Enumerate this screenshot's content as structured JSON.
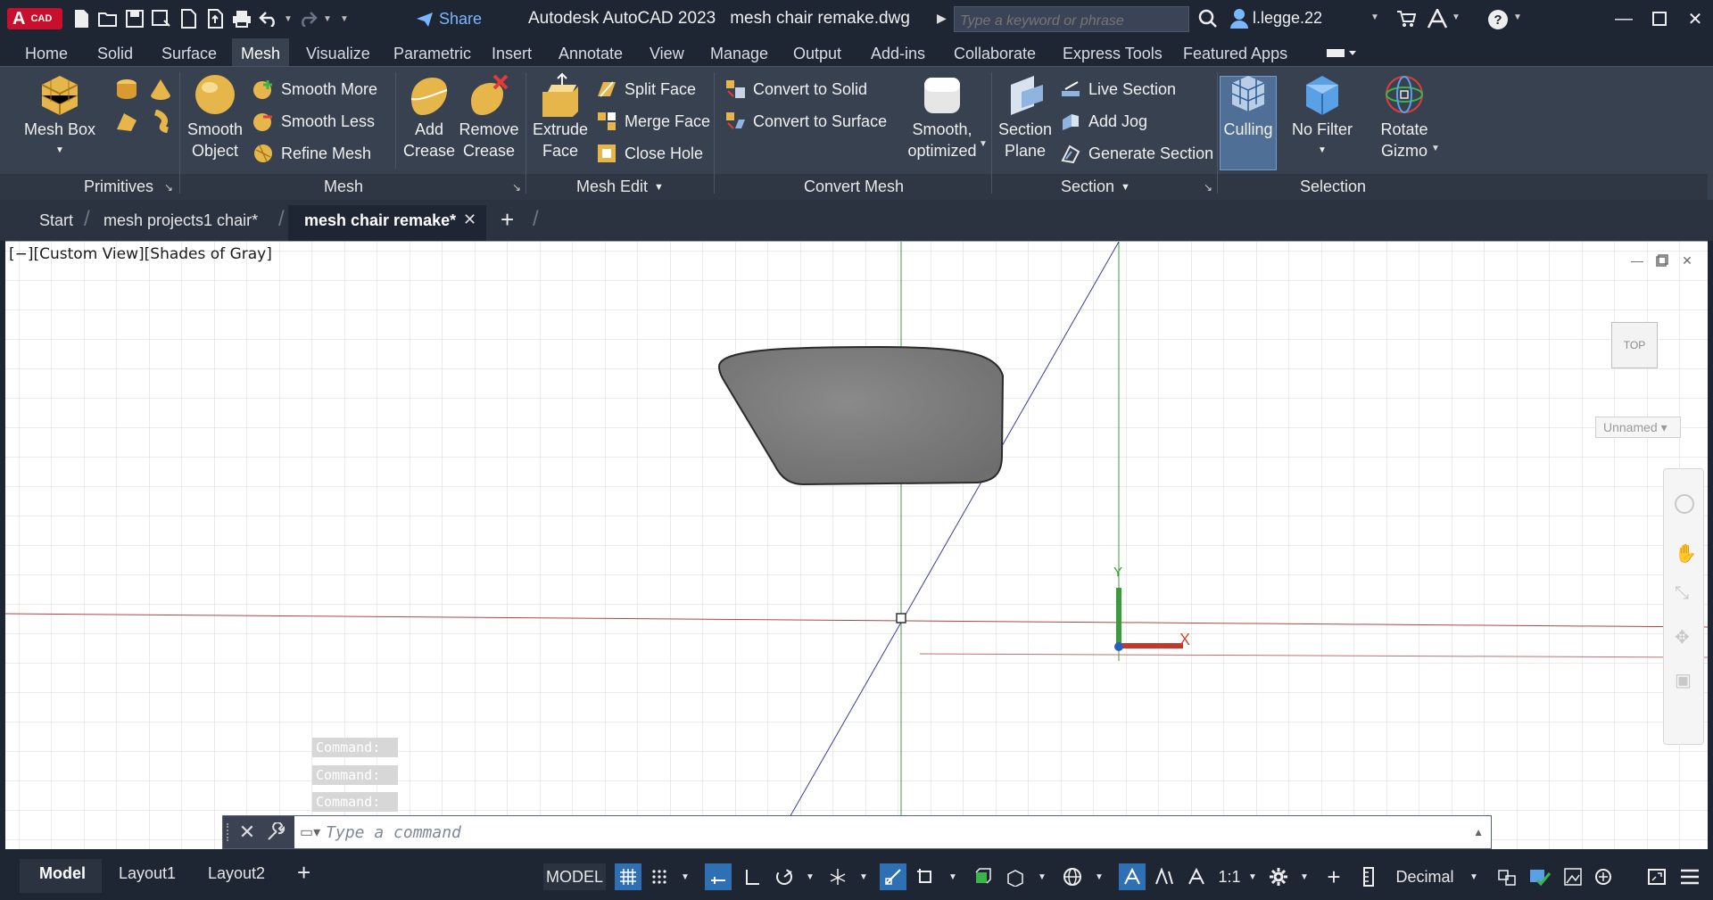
{
  "app": {
    "logo_letter": "A",
    "logo_suffix": "CAD",
    "product": "Autodesk AutoCAD 2023",
    "document": "mesh chair remake.dwg",
    "share_label": "Share",
    "search_placeholder": "Type a keyword or phrase",
    "username": "l.legge.22"
  },
  "ribbon_tabs": [
    "Home",
    "Solid",
    "Surface",
    "Mesh",
    "Visualize",
    "Parametric",
    "Insert",
    "Annotate",
    "View",
    "Manage",
    "Output",
    "Add-ins",
    "Collaborate",
    "Express Tools",
    "Featured Apps"
  ],
  "ribbon_active_tab": "Mesh",
  "ribbon": {
    "mesh_box": {
      "line1": "Mesh Box"
    },
    "smooth_object": {
      "line1": "Smooth",
      "line2": "Object"
    },
    "smooth_more": "Smooth More",
    "smooth_less": "Smooth Less",
    "refine_mesh": "Refine Mesh",
    "add_crease": {
      "line1": "Add",
      "line2": "Crease"
    },
    "remove_crease": {
      "line1": "Remove",
      "line2": "Crease"
    },
    "extrude_face": {
      "line1": "Extrude",
      "line2": "Face"
    },
    "split_face": "Split Face",
    "merge_face": "Merge Face",
    "close_hole": "Close Hole",
    "convert_to_solid": "Convert to Solid",
    "convert_to_surface": "Convert to Surface",
    "smooth_optimized": {
      "line1": "Smooth,",
      "line2": "optimized"
    },
    "section_plane": {
      "line1": "Section",
      "line2": "Plane"
    },
    "live_section": "Live Section",
    "add_jog": "Add Jog",
    "generate_section": "Generate Section",
    "culling": "Culling",
    "no_filter": "No Filter",
    "rotate_gizmo": {
      "line1": "Rotate",
      "line2": "Gizmo"
    },
    "panels": {
      "primitives": "Primitives",
      "mesh": "Mesh",
      "mesh_edit": "Mesh Edit",
      "convert_mesh": "Convert Mesh",
      "section": "Section",
      "selection": "Selection"
    }
  },
  "doc_tabs": [
    "Start",
    "mesh projects1 chair*",
    "mesh chair remake*"
  ],
  "viewport": {
    "label": "[−][Custom View][Shades of Gray]",
    "viewcube_face": "TOP",
    "ucs_name": "Unnamed",
    "axis_x": "X",
    "axis_y": "Y"
  },
  "command_history": [
    "Command:",
    "Command:",
    "Command:"
  ],
  "command_placeholder": "Type a command",
  "layout_tabs": [
    "Model",
    "Layout1",
    "Layout2"
  ],
  "status": {
    "model_label": "MODEL",
    "scale": "1:1",
    "units": "Decimal"
  },
  "colors": {
    "accent": "#2f6fb4",
    "dark_bg": "#1e2533",
    "ribbon_bg": "#38414f",
    "x_axis": "#c0392b",
    "y_axis": "#2e8b2e",
    "mesh_gray": "#7c7c7c"
  }
}
